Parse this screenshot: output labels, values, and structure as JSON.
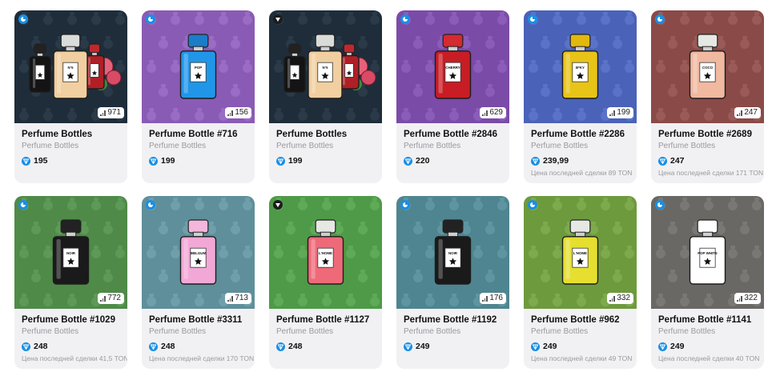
{
  "collection": "Perfume Bottles",
  "colors": {
    "ton": "#1a8fe3",
    "card_bg": "#f1f1f3"
  },
  "cards": [
    {
      "title": "Perfume Bottles",
      "subtitle": "Perfume Bottles",
      "price": "195",
      "count": "971",
      "last_sale": "",
      "badge": "blue",
      "bg": "#1f2d3a",
      "pattern": "#2a3a48",
      "kind": "multi",
      "labels": [
        "N°5"
      ]
    },
    {
      "title": "Perfume Bottle #716",
      "subtitle": "Perfume Bottles",
      "price": "199",
      "count": "156",
      "last_sale": "",
      "badge": "blue",
      "bg": "#8a5bb5",
      "pattern": "#9a6cc4",
      "kind": "single",
      "liquid": "#2196e8",
      "cap": "#1b7cc9",
      "label": "POP"
    },
    {
      "title": "Perfume Bottles",
      "subtitle": "Perfume Bottles",
      "price": "199",
      "count": "",
      "last_sale": "",
      "badge": "dark",
      "bg": "#1f2d3a",
      "pattern": "#2a3a48",
      "kind": "multi",
      "labels": [
        "N°5"
      ]
    },
    {
      "title": "Perfume Bottle #2846",
      "subtitle": "Perfume Bottles",
      "price": "220",
      "count": "629",
      "last_sale": "",
      "badge": "blue",
      "bg": "#7b4ba8",
      "pattern": "#8c5cba",
      "kind": "single",
      "liquid": "#c81d25",
      "cap": "#d42a30",
      "label": "CHERRY"
    },
    {
      "title": "Perfume Bottle #2286",
      "subtitle": "Perfume Bottles",
      "price": "239,99",
      "count": "199",
      "last_sale": "Цена последней сделки 89 TON",
      "badge": "blue",
      "bg": "#4a63b8",
      "pattern": "#5a73c8",
      "kind": "single",
      "liquid": "#e8c418",
      "cap": "#e3b80d",
      "label": "B*KY"
    },
    {
      "title": "Perfume Bottle #2689",
      "subtitle": "Perfume Bottles",
      "price": "247",
      "count": "247",
      "last_sale": "Цена последней сделки 171 TON",
      "badge": "blue",
      "bg": "#8a4a48",
      "pattern": "#9a5a58",
      "kind": "single",
      "liquid": "#f0b9a0",
      "cap": "#e6e8e4",
      "label": "COCO"
    },
    {
      "title": "Perfume Bottle #1029",
      "subtitle": "Perfume Bottles",
      "price": "248",
      "count": "772",
      "last_sale": "Цена последней сделки 41,5 TON",
      "badge": "blue",
      "bg": "#4f8a48",
      "pattern": "#5e9a57",
      "kind": "single",
      "liquid": "#1a1a1a",
      "cap": "#222222",
      "label": "NOIR"
    },
    {
      "title": "Perfume Bottle #3311",
      "subtitle": "Perfume Bottles",
      "price": "248",
      "count": "713",
      "last_sale": "Цена последней сделки 170 TON",
      "badge": "blue",
      "bg": "#5f8f9a",
      "pattern": "#6f9faa",
      "kind": "single",
      "liquid": "#f2a8d6",
      "cap": "#f4b6dc",
      "label": "BBLGUM"
    },
    {
      "title": "Perfume Bottle #1127",
      "subtitle": "Perfume Bottles",
      "price": "248",
      "count": "",
      "last_sale": "",
      "badge": "dark",
      "bg": "#4e9a48",
      "pattern": "#5eaa57",
      "kind": "single",
      "liquid": "#ee6a78",
      "cap": "#e6e8e4",
      "label": "L'HOME"
    },
    {
      "title": "Perfume Bottle #1192",
      "subtitle": "Perfume Bottles",
      "price": "249",
      "count": "176",
      "last_sale": "",
      "badge": "blue",
      "bg": "#4f8590",
      "pattern": "#5f95a0",
      "kind": "single",
      "liquid": "#1a1a1a",
      "cap": "#222222",
      "label": "NOIR"
    },
    {
      "title": "Perfume Bottle #962",
      "subtitle": "Perfume Bottles",
      "price": "249",
      "count": "332",
      "last_sale": "Цена последней сделки 49 TON",
      "badge": "blue",
      "bg": "#6e9a3e",
      "pattern": "#7eaa4e",
      "kind": "single",
      "liquid": "#e6df30",
      "cap": "#e6e8e4",
      "label": "L'HOME"
    },
    {
      "title": "Perfume Bottle #1141",
      "subtitle": "Perfume Bottles",
      "price": "249",
      "count": "322",
      "last_sale": "Цена последней сделки 40 TON",
      "badge": "blue",
      "bg": "#6a6864",
      "pattern": "#7a7874",
      "kind": "single",
      "liquid": "#ffffff",
      "cap": "#ffffff",
      "label": "POP WHITE"
    }
  ]
}
